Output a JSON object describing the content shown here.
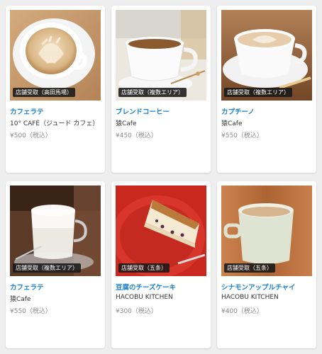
{
  "items": [
    {
      "title": "カフェラテ",
      "shop": "10° CAFÉ（ジュード カフェ）",
      "price": "¥500（税込）",
      "badge": "店舗受取（高田馬場）",
      "image": "latte-art-thank-you-photo"
    },
    {
      "title": "ブレンドコーヒー",
      "shop": "猿Cafe",
      "price": "¥450（税込）",
      "badge": "店舗受取（複数エリア）",
      "image": "blend-coffee-cup-photo"
    },
    {
      "title": "カプチーノ",
      "shop": "猿Cafe",
      "price": "¥550（税込）",
      "badge": "店舗受取（複数エリア）",
      "image": "cappuccino-cup-photo"
    },
    {
      "title": "カフェラテ",
      "shop": "猿Cafe",
      "price": "¥550（税込）",
      "badge": "店舗受取（複数エリア）",
      "image": "cafe-latte-glass-photo"
    },
    {
      "title": "豆腐のチーズケーキ",
      "shop": "HACOBU KITCHEN",
      "price": "¥300（税込）",
      "badge": "店舗受取（五条）",
      "image": "tofu-cheesecake-photo"
    },
    {
      "title": "シナモンアップルチャイ",
      "shop": "HACOBU KITCHEN",
      "price": "¥400（税込）",
      "badge": "店舗受取（五条）",
      "image": "cinnamon-apple-chai-photo"
    }
  ]
}
